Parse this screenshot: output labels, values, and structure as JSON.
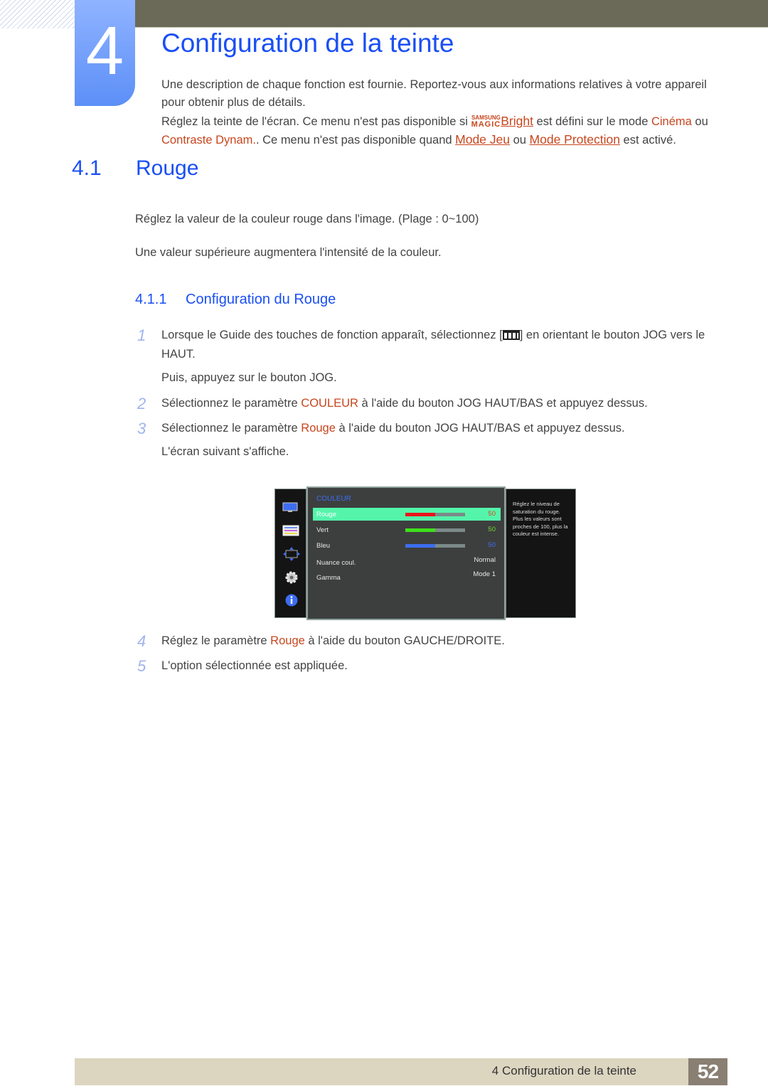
{
  "chapter": {
    "number": "4",
    "title": "Configuration de la teinte",
    "intro_1": "Une description de chaque fonction est fournie. Reportez-vous aux informations relatives à votre appareil pour obtenir plus de détails.",
    "intro_2_a": "Réglez la teinte de l'écran. Ce menu n'est pas disponible si ",
    "magic_top": "SAMSUNG",
    "magic_bottom": "MAGIC",
    "bright_link": "Bright",
    "intro_2_b": " est défini sur le mode ",
    "cinema": "Cinéma",
    "intro_2_c": " ou ",
    "contraste": "Contraste Dynam.",
    "intro_2_d": ". Ce menu n'est pas disponible quand ",
    "mode_jeu_link": "Mode Jeu",
    "intro_2_e": " ou ",
    "mode_protection_link": "Mode Protection",
    "intro_2_f": " est activé."
  },
  "section": {
    "number": "4.1",
    "title": "Rouge",
    "para_1": "Réglez la valeur de la couleur rouge dans l'image. (Plage : 0~100)",
    "para_2": "Une valeur supérieure augmentera l'intensité de la couleur."
  },
  "subsection": {
    "number": "4.1.1",
    "title": "Configuration du Rouge"
  },
  "steps": [
    {
      "n": "1",
      "a": "Lorsque le Guide des touches de fonction apparaît, sélectionnez [",
      "b": "] en orientant le bouton JOG vers le HAUT.",
      "c": "Puis, appuyez sur le bouton JOG."
    },
    {
      "n": "2",
      "a": "Sélectionnez le paramètre ",
      "hl": "COULEUR",
      "b": " à l'aide du bouton JOG HAUT/BAS et appuyez dessus."
    },
    {
      "n": "3",
      "a": "Sélectionnez le paramètre ",
      "hl": "Rouge",
      "b": " à l'aide du bouton JOG HAUT/BAS et appuyez dessus.",
      "c": "L'écran suivant s'affiche."
    },
    {
      "n": "4",
      "a": "Réglez le paramètre ",
      "hl": "Rouge",
      "b": " à l'aide du bouton GAUCHE/DROITE."
    },
    {
      "n": "5",
      "a": "L'option sélectionnée est appliquée."
    }
  ],
  "osd": {
    "sidebar_icons": [
      "picture-icon",
      "color-icon",
      "size-position-icon",
      "settings-icon",
      "info-icon"
    ],
    "header": "COULEUR",
    "rows": [
      {
        "label": "Rouge",
        "value": "50",
        "level": 0.5,
        "color": "#e8141b",
        "value_color": "#e0441c",
        "selected": true
      },
      {
        "label": "Vert",
        "value": "50",
        "level": 0.5,
        "color": "#3fe01c",
        "value_color": "#6fd62a"
      },
      {
        "label": "Bleu",
        "value": "50",
        "level": 0.5,
        "color": "#3d6df0",
        "value_color": "#3d6df0"
      },
      {
        "label": "Nuance coul.",
        "value": "Normal"
      },
      {
        "label": "Gamma",
        "value": "Mode 1"
      }
    ],
    "help_text": "Réglez le niveau de saturation du rouge. Plus les valeurs sont proches de 100, plus la couleur est intense."
  },
  "footer": {
    "title": "4 Configuration de la teinte",
    "page": "52"
  },
  "colors": {
    "accent_blue": "#1a4ff5",
    "highlight_orange": "#c8461e",
    "topbar": "#6b6a58",
    "footer_bg": "#dcd5c0",
    "page_box": "#8a7f73"
  }
}
